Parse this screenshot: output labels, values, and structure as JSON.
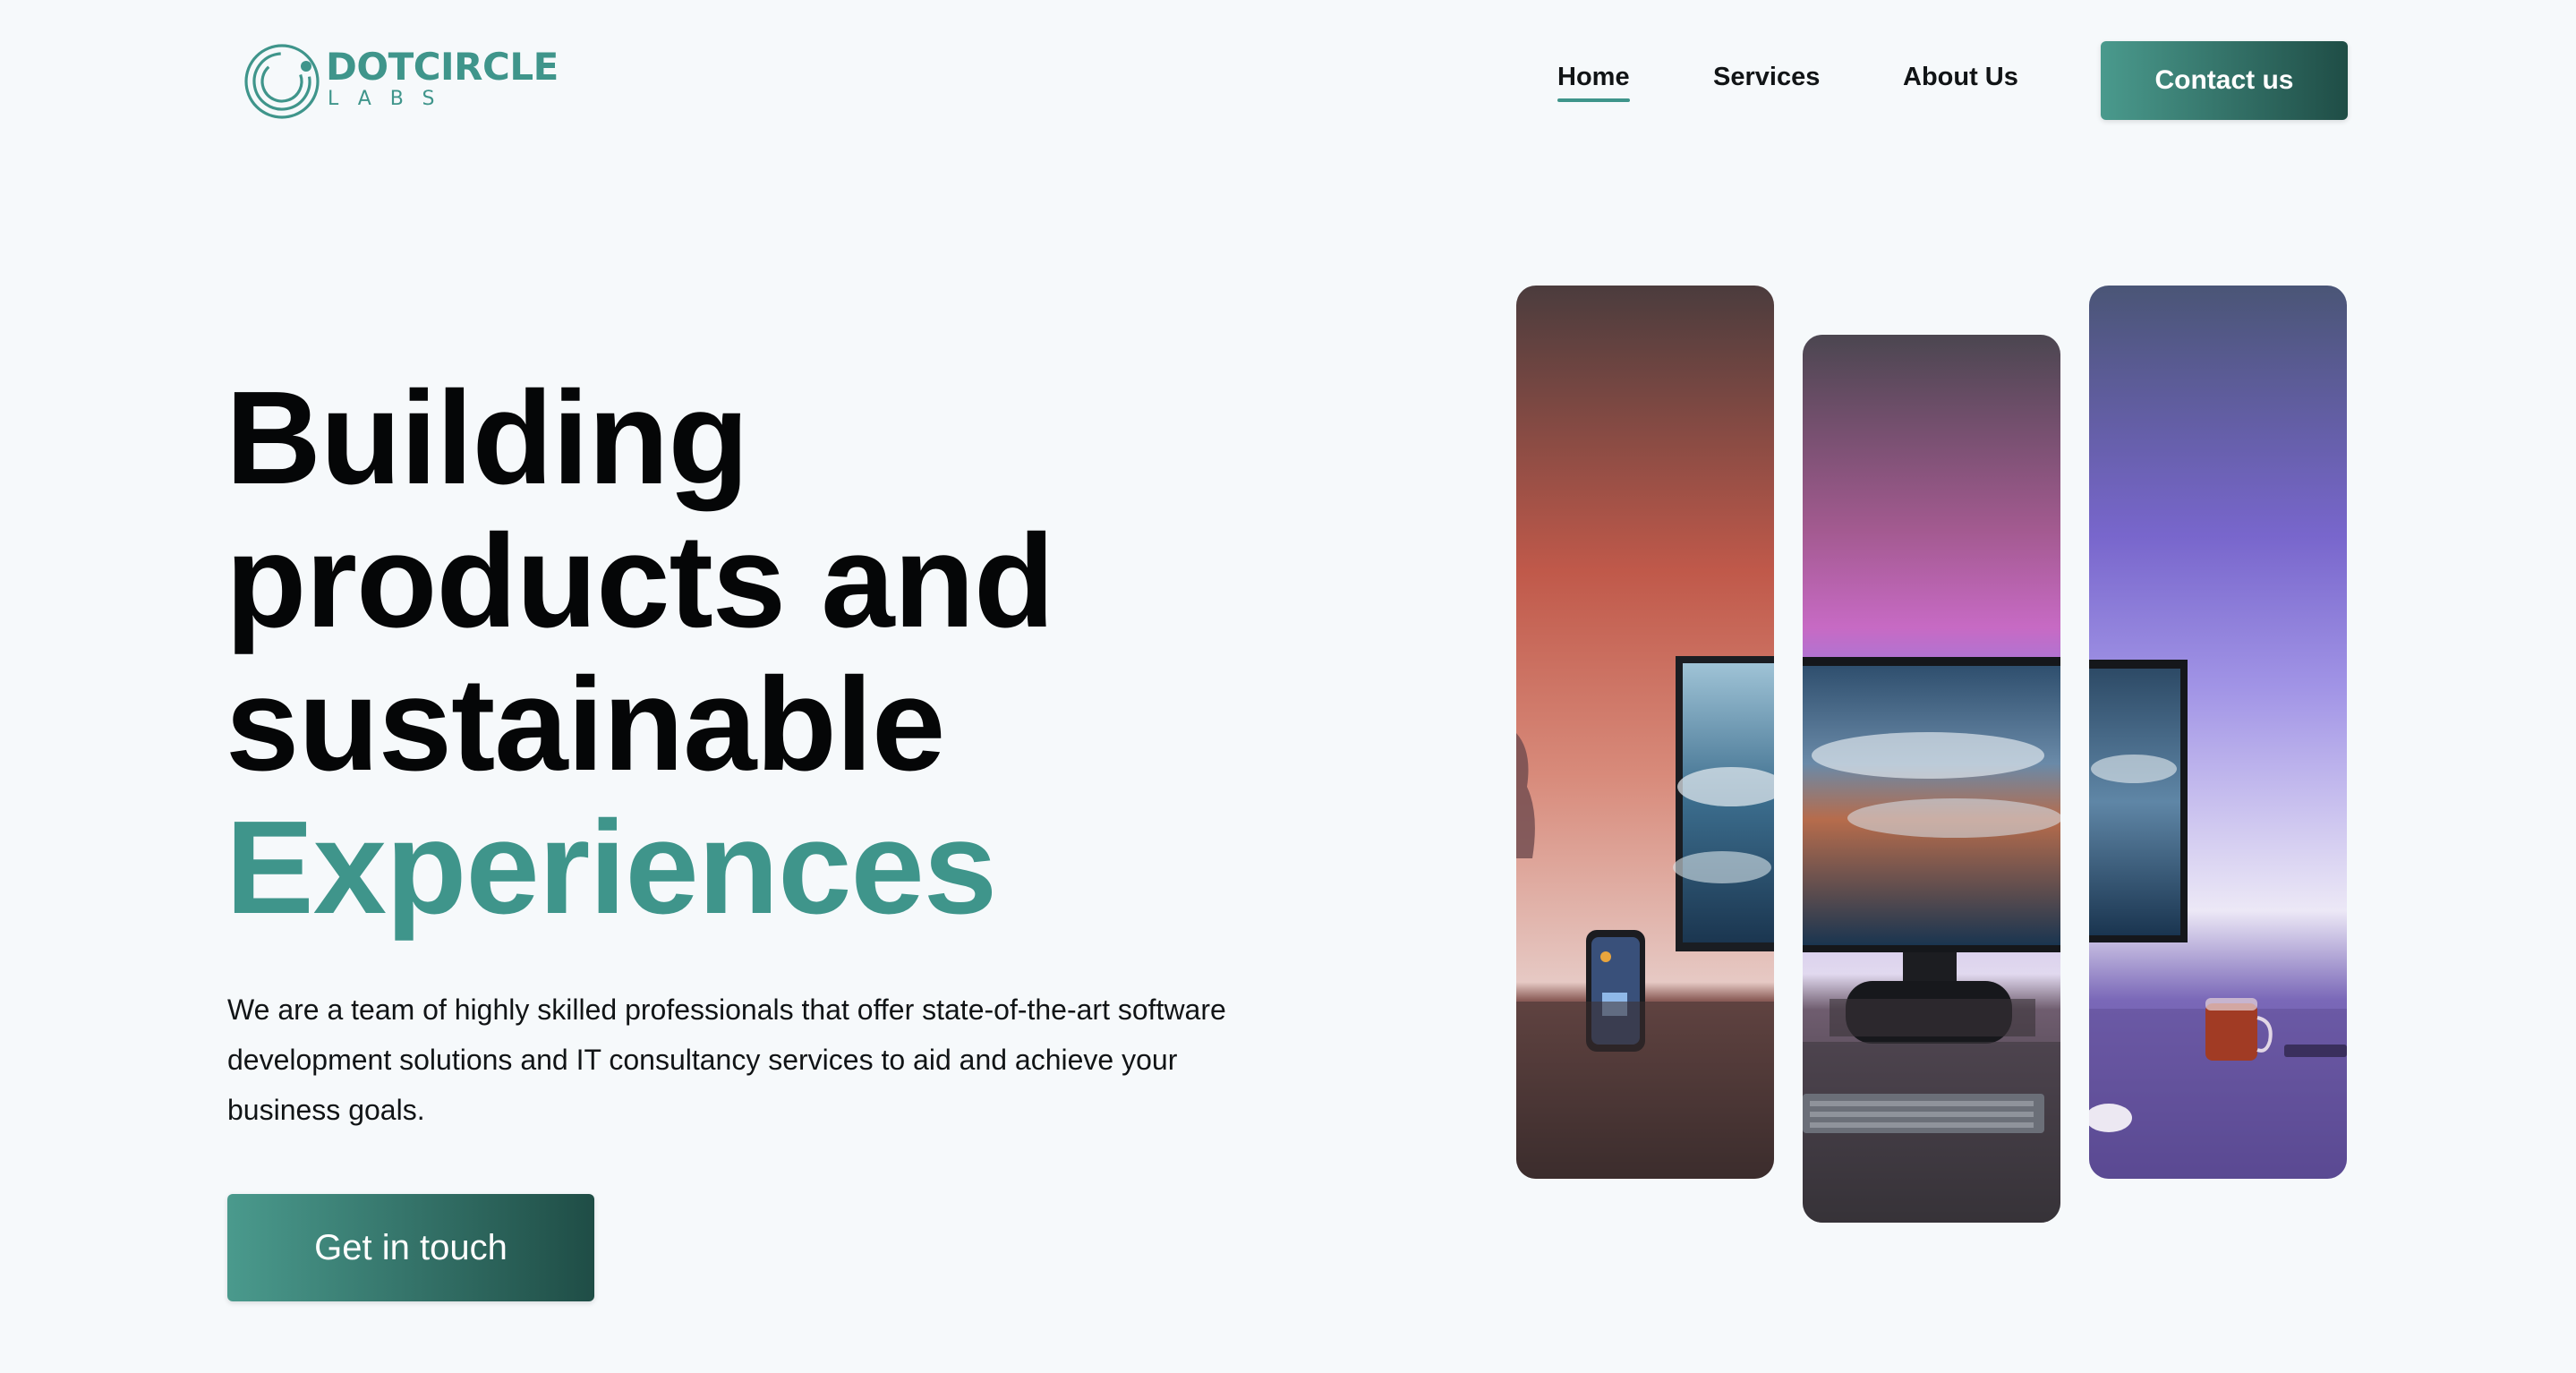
{
  "brand": {
    "name": "DOTCIRCLE",
    "sub": "LABS",
    "accent_color": "#3f958b",
    "logo_icon": "concentric-circles-logo"
  },
  "nav": {
    "items": [
      {
        "label": "Home",
        "active": true
      },
      {
        "label": "Services",
        "active": false
      },
      {
        "label": "About Us",
        "active": false
      }
    ],
    "cta_label": "Contact us"
  },
  "hero": {
    "title_lines": [
      "Building",
      "products and",
      "sustainable"
    ],
    "title_accent": "Experiences",
    "description": "We are a team of highly skilled professionals that offer state-of-the-art software development solutions and IT consultancy services to aid and achieve your business goals.",
    "cta_label": "Get in touch"
  },
  "gallery": {
    "images": [
      {
        "subject": "desk-setup-photo-left"
      },
      {
        "subject": "desk-setup-photo-center"
      },
      {
        "subject": "desk-setup-photo-right"
      }
    ]
  }
}
